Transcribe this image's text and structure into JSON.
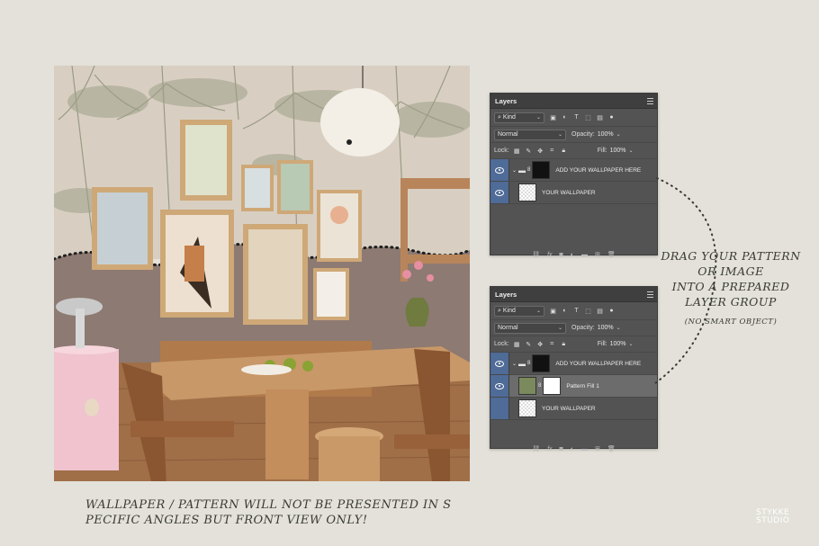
{
  "panel1": {
    "title": "Layers",
    "filter_kind": "Kind",
    "blend_mode": "Normal",
    "opacity_label": "Opacity:",
    "opacity_value": "100%",
    "lock_label": "Lock:",
    "fill_label": "Fill:",
    "fill_value": "100%",
    "layers": [
      {
        "name": "ADD YOUR WALLPAPER HERE"
      },
      {
        "name": "YOUR WALLPAPER"
      }
    ]
  },
  "panel2": {
    "title": "Layers",
    "filter_kind": "Kind",
    "blend_mode": "Normal",
    "opacity_label": "Opacity:",
    "opacity_value": "100%",
    "lock_label": "Lock:",
    "fill_label": "Fill:",
    "fill_value": "100%",
    "layers": [
      {
        "name": "ADD YOUR WALLPAPER HERE"
      },
      {
        "name": "Pattern Fill 1"
      },
      {
        "name": "YOUR WALLPAPER"
      }
    ]
  },
  "captions": {
    "right_line1": "DRAG YOUR PATTERN",
    "right_line2": "OR IMAGE",
    "right_line3": "INTO A PREPARED",
    "right_line4": "LAYER GROUP",
    "right_sub": "(NO SMART OBJECT)",
    "bottom_line1": "WALLPAPER / PATTERN WILL NOT BE PRESENTED IN S",
    "bottom_line2": "PECIFIC ANGLES BUT FRONT VIEW ONLY!"
  },
  "logo": {
    "line1": "STYKKE",
    "line2": "STUDIO"
  },
  "colors": {
    "background": "#e3e1d9",
    "panel": "#535353",
    "selected_layer": "#6c6c6c",
    "eye_column": "#4f6b97"
  }
}
